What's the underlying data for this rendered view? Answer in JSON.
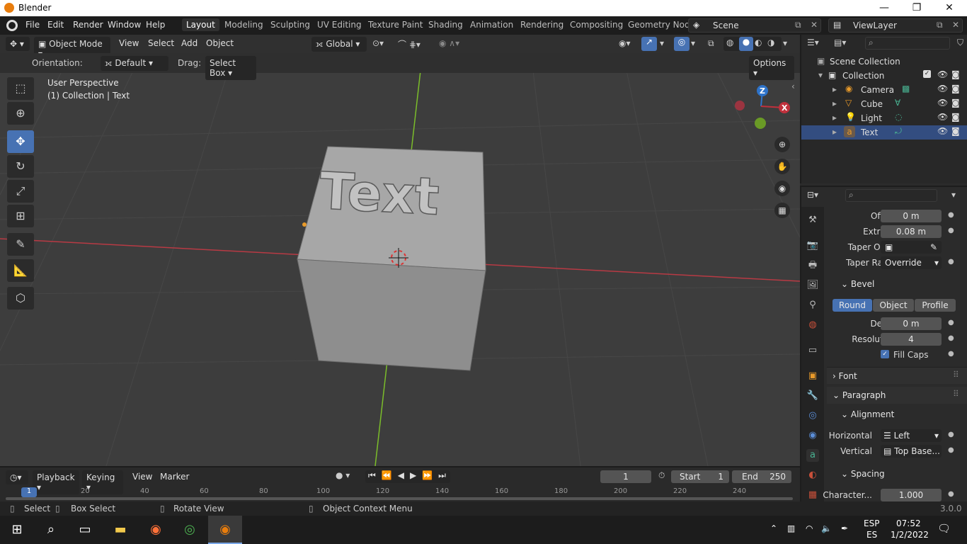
{
  "window": {
    "title": "Blender",
    "controls": [
      "—",
      "❐",
      "✕"
    ]
  },
  "menubar": {
    "items": [
      "File",
      "Edit",
      "Render",
      "Window",
      "Help"
    ]
  },
  "workspaces": [
    "Layout",
    "Modeling",
    "Sculpting",
    "UV Editing",
    "Texture Paint",
    "Shading",
    "Animation",
    "Rendering",
    "Compositing",
    "Geometry Nod"
  ],
  "scene": {
    "name": "Scene",
    "view_layer": "ViewLayer"
  },
  "header3d": {
    "mode": "Object Mode",
    "menus": [
      "View",
      "Select",
      "Add",
      "Object"
    ],
    "transform": "Global"
  },
  "toolopts": {
    "orientation_label": "Orientation:",
    "orientation": "Default",
    "drag_label": "Drag:",
    "drag": "Select Box",
    "options": "Options"
  },
  "viewport": {
    "perspective": "User Perspective",
    "context": "(1) Collection | Text",
    "object_text": "Text",
    "gizmo": {
      "z": "Z",
      "x": "X"
    }
  },
  "outliner": {
    "root": "Scene Collection",
    "collection": "Collection",
    "items": [
      "Camera",
      "Cube",
      "Light",
      "Text"
    ]
  },
  "properties": {
    "offset_label": "Offset",
    "offset": "0 m",
    "extrude_label": "Extrude",
    "extrude": "0.08 m",
    "taper_obj_label": "Taper Obj...",
    "taper_rad_label": "Taper Rad...",
    "taper_rad": "Override",
    "bevel": "Bevel",
    "bevel_modes": [
      "Round",
      "Object",
      "Profile"
    ],
    "depth_label": "Depth",
    "depth": "0 m",
    "resolution_label": "Resolution",
    "resolution": "4",
    "fill_caps": "Fill Caps",
    "font": "Font",
    "paragraph": "Paragraph",
    "alignment": "Alignment",
    "horizontal_label": "Horizontal",
    "horizontal": "Left",
    "vertical_label": "Vertical",
    "vertical": "Top Base...",
    "spacing": "Spacing",
    "character_label": "Character...",
    "character": "1.000"
  },
  "timeline": {
    "menus": [
      "Playback",
      "Keying",
      "View",
      "Marker"
    ],
    "current_frame": "1",
    "start_label": "Start",
    "start": "1",
    "end_label": "End",
    "end": "250",
    "ruler": [
      "1",
      "20",
      "40",
      "60",
      "80",
      "100",
      "120",
      "140",
      "160",
      "180",
      "200",
      "220",
      "240"
    ]
  },
  "statusbar": {
    "select": "Select",
    "box_select": "Box Select",
    "rotate": "Rotate View",
    "context_menu": "Object Context Menu",
    "version": "3.0.0"
  },
  "taskbar": {
    "lang1": "ESP",
    "lang2": "ES",
    "time": "07:52",
    "date": "1/2/2022"
  },
  "colors": {
    "accent": "#4772b3",
    "x_axis": "#c0303c",
    "y_axis": "#7bbd2a",
    "z_axis": "#2e73c9",
    "blender_orange": "#e87d0d"
  }
}
